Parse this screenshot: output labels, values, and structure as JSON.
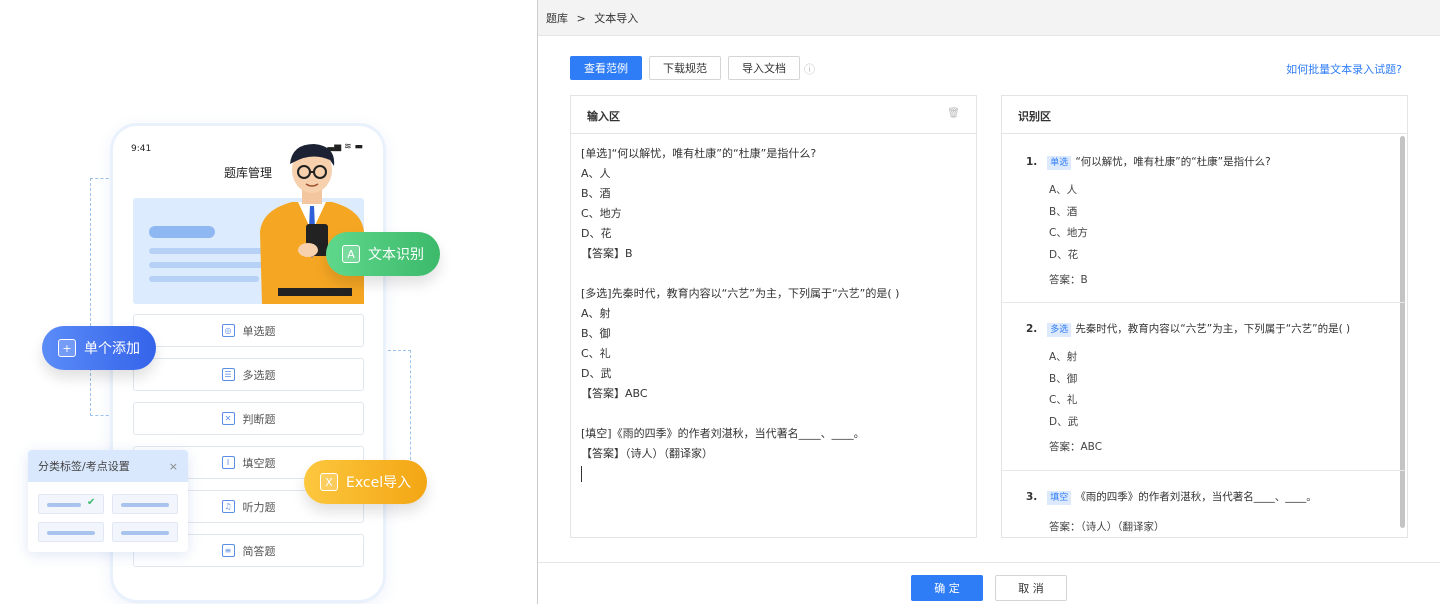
{
  "illustration": {
    "phone": {
      "time": "9:41",
      "status": "▂▃▅ ≋ ▬",
      "title": "题库管理"
    },
    "question_types": [
      {
        "icon": "radio-icon",
        "glyph": "◎",
        "label": "单选题"
      },
      {
        "icon": "list-icon",
        "glyph": "☰",
        "label": "多选题"
      },
      {
        "icon": "cross-box-icon",
        "glyph": "✕",
        "label": "判断题"
      },
      {
        "icon": "text-cursor-icon",
        "glyph": "I",
        "label": "填空题"
      },
      {
        "icon": "headphones-icon",
        "glyph": "♫",
        "label": "听力题"
      },
      {
        "icon": "document-icon",
        "glyph": "≡",
        "label": "简答题"
      }
    ],
    "badges": {
      "text_recognition": {
        "glyph": "A",
        "label": "文本识别",
        "color": "#4cc779"
      },
      "single_add": {
        "glyph": "+",
        "label": "单个添加",
        "color": "#3d6df2"
      },
      "excel_import": {
        "glyph": "X",
        "label": "Excel导入",
        "color": "#f7b321"
      }
    },
    "tag_card": {
      "title": "分类标签/考点设置",
      "close": "×",
      "check": "✔"
    }
  },
  "app": {
    "breadcrumb": {
      "root": "题库",
      "sep": ">",
      "current": "文本导入"
    },
    "toolbar": {
      "view_example": "查看范例",
      "download_spec": "下载规范",
      "import_doc": "导入文档",
      "info": "ⓘ",
      "help_link": "如何批量文本录入试题?"
    },
    "input_panel": {
      "title": "输入区",
      "trash": "🗑",
      "lines": [
        "[单选]“何以解忧，唯有杜康”的“杜康”是指什么?",
        "A、人",
        "B、酒",
        "C、地方",
        "D、花",
        "【答案】B",
        "",
        "[多选]先秦时代，教育内容以“六艺”为主，下列属于“六艺”的是(   )",
        "A、射",
        "B、御",
        "C、礼",
        "D、武",
        "【答案】ABC",
        "",
        "[填空]《雨的四季》的作者刘湛秋，当代著名____、____。",
        "【答案】（诗人）（翻译家）"
      ]
    },
    "result_panel": {
      "title": "识别区",
      "questions": [
        {
          "num": "1.",
          "type": "单选",
          "stem": "“何以解忧，唯有杜康”的“杜康”是指什么?",
          "options": [
            "A、人",
            "B、酒",
            "C、地方",
            "D、花"
          ],
          "answer": "答案：B"
        },
        {
          "num": "2.",
          "type": "多选",
          "stem": "先秦时代，教育内容以“六艺”为主，下列属于“六艺”的是(   )",
          "options": [
            "A、射",
            "B、御",
            "C、礼",
            "D、武"
          ],
          "answer": "答案：ABC"
        },
        {
          "num": "3.",
          "type": "填空",
          "stem": "《雨的四季》的作者刘湛秋，当代著名____、____。",
          "options": [],
          "answer": "答案：（诗人）（翻译家）"
        }
      ]
    },
    "footer": {
      "confirm": "确 定",
      "cancel": "取 消"
    },
    "colors": {
      "primary": "#2f7df6"
    }
  }
}
